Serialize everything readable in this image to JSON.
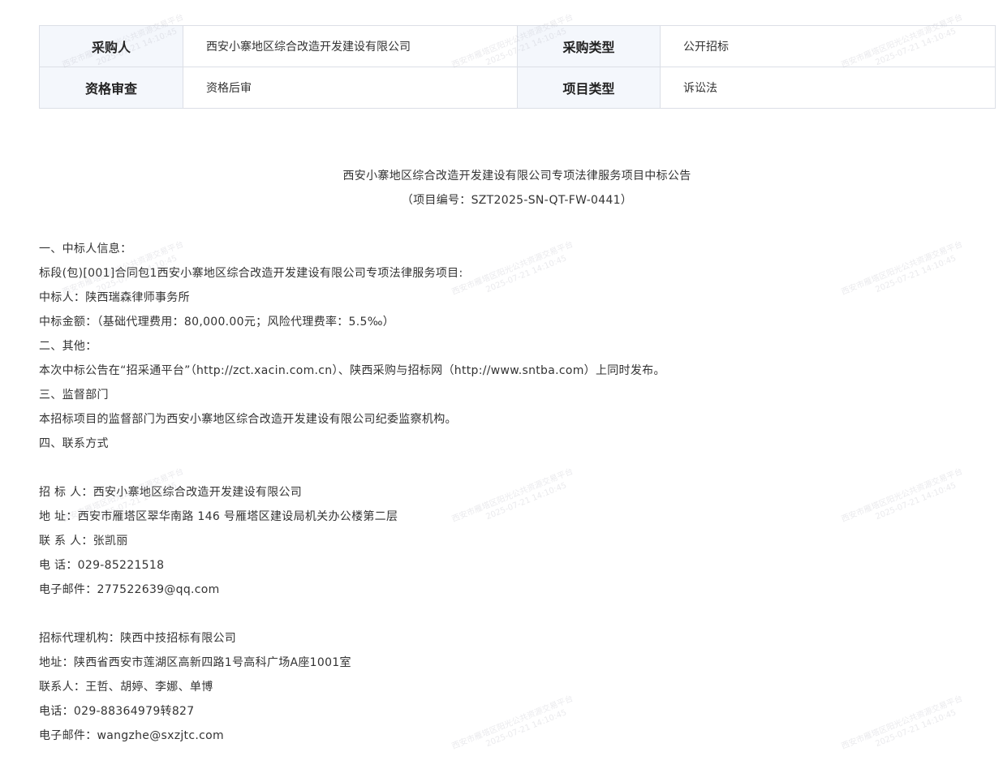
{
  "info_table": {
    "rows": [
      [
        {
          "label": "采购人",
          "value": "西安小寨地区综合改造开发建设有限公司"
        },
        {
          "label": "采购类型",
          "value": "公开招标"
        }
      ],
      [
        {
          "label": "资格审查",
          "value": "资格后审"
        },
        {
          "label": "项目类型",
          "value": "诉讼法"
        }
      ]
    ]
  },
  "notice": {
    "title": "西安小寨地区综合改造开发建设有限公司专项法律服务项目中标公告",
    "project_no": "（项目编号：SZT2025-SN-QT-FW-0441）",
    "winner_heading": "一、中标人信息：",
    "lot": "标段(包)[001]合同包1西安小寨地区综合改造开发建设有限公司专项法律服务项目:",
    "winner": "中标人：陕西瑞森律师事务所",
    "amount": "中标金额：（基础代理费用：80,000.00元；风险代理费率：5.5‰）",
    "other_heading": "二、其他：",
    "publish": "本次中标公告在“招采通平台”（http://zct.xacin.com.cn）、陕西采购与招标网（http://www.sntba.com）上同时发布。",
    "supervision_heading": "三、监督部门",
    "supervision": "本招标项目的监督部门为西安小寨地区综合改造开发建设有限公司纪委监察机构。",
    "contact_heading": "四、联系方式",
    "tenderer": {
      "name": "招 标 人：西安小寨地区综合改造开发建设有限公司",
      "address": "地 址：西安市雁塔区翠华南路 146 号雁塔区建设局机关办公楼第二层",
      "contact": "联 系 人：张凯丽",
      "phone": "电 话：029-85221518",
      "email": "电子邮件：277522639@qq.com"
    },
    "agency": {
      "name": "招标代理机构：陕西中技招标有限公司",
      "address": "地址：陕西省西安市莲湖区高新四路1号高科广场A座1001室",
      "contact": "联系人：王哲、胡婷、李娜、单博",
      "phone": "电话：029-88364979转827",
      "email": "电子邮件：wangzhe@sxzjtc.com"
    }
  },
  "watermark": {
    "line1": "西安市雁塔区阳光公共资源交易平台",
    "line2": "2025-07-21 14:10:45"
  }
}
